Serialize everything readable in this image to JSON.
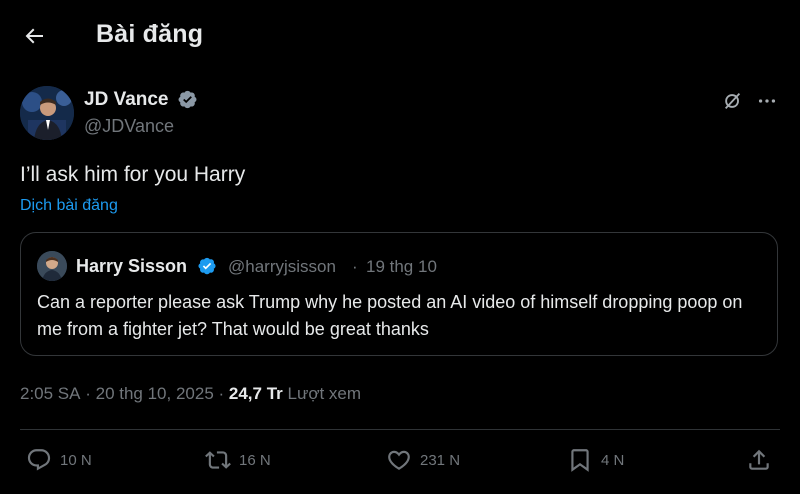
{
  "header": {
    "title": "Bài đăng"
  },
  "post": {
    "author_name": "JD Vance",
    "author_handle": "@JDVance",
    "text": "I’ll ask him for you Harry",
    "translate_label": "Dịch bài đăng",
    "time": "2:05 SA",
    "date": "20 thg 10, 2025",
    "views_count": "24,7 Tr",
    "views_label": "Lượt xem"
  },
  "quote": {
    "author_name": "Harry Sisson",
    "author_handle": "@harryjsisson",
    "date": "19 thg 10",
    "text": "Can a reporter please ask Trump why he posted an AI video of himself dropping poop on me from a fighter jet? That would be great thanks"
  },
  "actions": {
    "replies": "10 N",
    "reposts": "16 N",
    "likes": "231 N",
    "bookmarks": "4 N"
  },
  "icons": [
    "back-arrow-icon",
    "verified-badge-icon",
    "grok-icon",
    "more-icon",
    "reply-icon",
    "repost-icon",
    "like-icon",
    "bookmark-icon",
    "share-icon"
  ],
  "colors": {
    "background": "#000000",
    "text": "#e7e9ea",
    "muted": "#71767b",
    "accent": "#1d9bf0"
  }
}
